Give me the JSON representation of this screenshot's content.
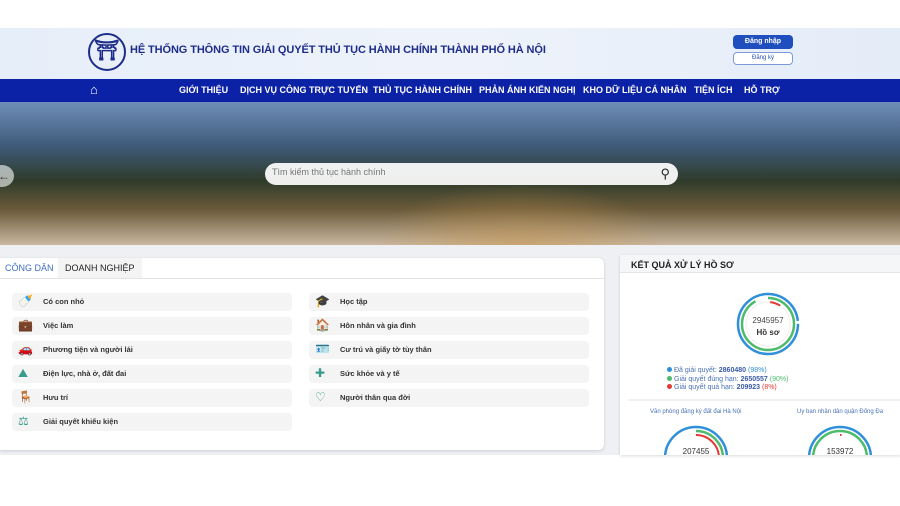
{
  "header": {
    "title": "HỆ THỐNG THÔNG TIN GIẢI QUYẾT THỦ TỤC HÀNH CHÍNH THÀNH PHỐ HÀ NỘI",
    "logo": "Hà Nội emblem",
    "login": "Đăng nhập",
    "register": "Đăng ký"
  },
  "nav": {
    "home_icon": "home-icon",
    "items": [
      "GIỚI THIỆU",
      "DỊCH VỤ CÔNG TRỰC TUYẾN",
      "THỦ TỤC HÀNH CHÍNH",
      "PHẢN ÁNH KIẾN NGHỊ",
      "KHO DỮ LIỆU CÁ NHÂN",
      "TIỆN ÍCH",
      "HỖ TRỢ"
    ]
  },
  "search": {
    "placeholder": "Tìm kiếm thủ tục hành chính"
  },
  "tabs": [
    {
      "label": "CÔNG DÂN",
      "active": true
    },
    {
      "label": "DOANH NGHIỆP",
      "active": false
    }
  ],
  "categories": [
    {
      "label": "Có con nhỏ",
      "icon": "baby-bottle-icon"
    },
    {
      "label": "Học tập",
      "icon": "graduation-cap-icon"
    },
    {
      "label": "Việc làm",
      "icon": "briefcase-icon"
    },
    {
      "label": "Hôn nhân và gia đình",
      "icon": "family-house-icon"
    },
    {
      "label": "Phương tiện và người lái",
      "icon": "car-icon"
    },
    {
      "label": "Cư trú và giấy tờ tùy thân",
      "icon": "id-card-icon"
    },
    {
      "label": "Điện lực, nhà ở, đất đai",
      "icon": "land-icon"
    },
    {
      "label": "Sức khỏe và y tế",
      "icon": "medical-kit-icon"
    },
    {
      "label": "Hưu trí",
      "icon": "bench-icon"
    },
    {
      "label": "Người thân qua đời",
      "icon": "heart-icon"
    },
    {
      "label": "Giải quyết khiếu kiện",
      "icon": "scales-icon"
    }
  ],
  "results": {
    "title": "KẾT QUẢ XỬ LÝ HỒ SƠ",
    "total": "2945957",
    "total_label": "Hồ sơ",
    "legend": [
      {
        "label": "Đã giải quyết:",
        "value": "2860480",
        "pct": "(98%)",
        "color": "#2f8fd8"
      },
      {
        "label": "Giải quyết đúng hạn:",
        "value": "2650557",
        "pct": "(90%)",
        "color": "#4cbb6c"
      },
      {
        "label": "Giải quyết quá hạn:",
        "value": "209923",
        "pct": "(8%)",
        "color": "#e53935"
      }
    ],
    "units": [
      {
        "name": "Văn phòng đăng ký đất đai Hà Nội",
        "total": "207455"
      },
      {
        "name": "Uy ban nhân dân quận Đống Đa",
        "total": "153972"
      }
    ]
  },
  "colors": {
    "nav": "#0c22a6",
    "brand": "#1f2d8a",
    "accent": "#3a9c8c"
  }
}
